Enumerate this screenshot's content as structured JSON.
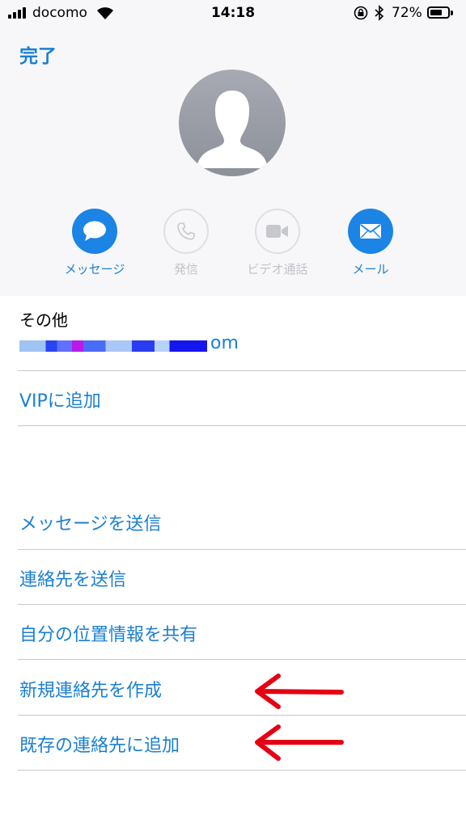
{
  "status_bar": {
    "carrier": "docomo",
    "time": "14:18",
    "battery": "72%",
    "battery_level": 0.72
  },
  "nav": {
    "done_label": "完了"
  },
  "actions": [
    {
      "label": "メッセージ",
      "icon": "message-bubble-icon",
      "enabled": true
    },
    {
      "label": "発信",
      "icon": "phone-icon",
      "enabled": false
    },
    {
      "label": "ビデオ通話",
      "icon": "video-camera-icon",
      "enabled": false
    },
    {
      "label": "メール",
      "icon": "envelope-icon",
      "enabled": true
    }
  ],
  "contact": {
    "email_section_label": "その他",
    "email_visible_suffix": "om"
  },
  "menu": {
    "vip": "VIPに追加",
    "send_message": "メッセージを送信",
    "send_contact": "連絡先を送信",
    "share_location": "自分の位置情報を共有",
    "create_contact": "新規連絡先を作成",
    "add_to_existing": "既存の連絡先に追加"
  },
  "colors": {
    "accent": "#1b7fd1",
    "action_blue": "#1b84e5",
    "annotation_arrow": "#e60012"
  }
}
